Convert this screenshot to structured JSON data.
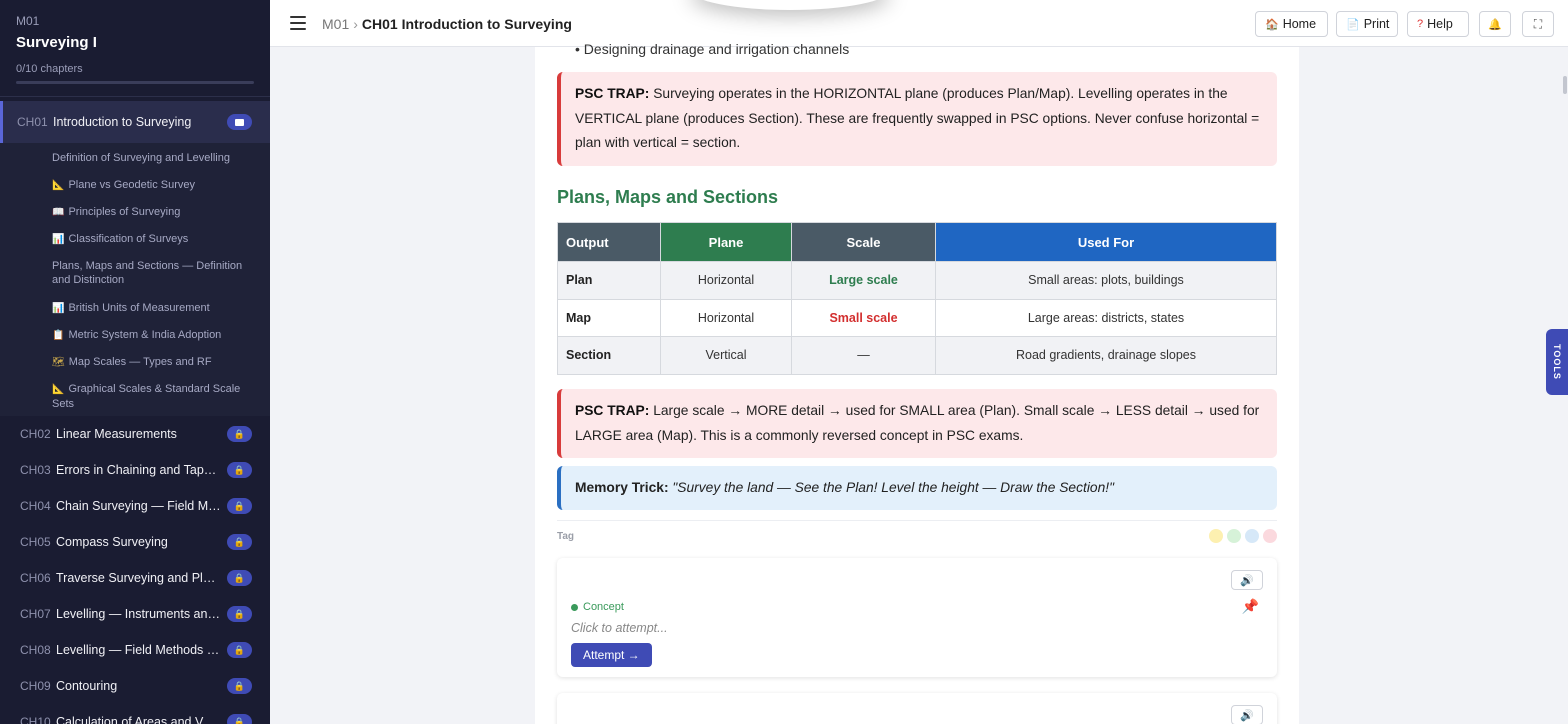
{
  "sidebar": {
    "module": "M01",
    "course_title": "Surveying I",
    "progress": "0/10 chapters",
    "progress_fraction": 0,
    "active_chapter": {
      "code": "CH01",
      "name": "Introduction to Surveying"
    },
    "subtopics": [
      {
        "icon": "",
        "label": "Definition of Surveying and Levelling"
      },
      {
        "icon": "📐",
        "label": "Plane vs Geodetic Survey"
      },
      {
        "icon": "📖",
        "label": "Principles of Surveying"
      },
      {
        "icon": "📊",
        "label": "Classification of Surveys"
      },
      {
        "icon": "",
        "label": "Plans, Maps and Sections — Definition and Distinction"
      },
      {
        "icon": "📊",
        "label": "British Units of Measurement"
      },
      {
        "icon": "📋",
        "label": "Metric System & India Adoption"
      },
      {
        "icon": "🗺",
        "label": "Map Scales — Types and RF"
      },
      {
        "icon": "📐",
        "label": "Graphical Scales & Standard Scale Sets"
      }
    ],
    "chapters": [
      {
        "code": "CH02",
        "name": "Linear Measurements"
      },
      {
        "code": "CH03",
        "name": "Errors in Chaining and Tape C..."
      },
      {
        "code": "CH04",
        "name": "Chain Surveying — Field Met..."
      },
      {
        "code": "CH05",
        "name": "Compass Surveying"
      },
      {
        "code": "CH06",
        "name": "Traverse Surveying and Plane ..."
      },
      {
        "code": "CH07",
        "name": "Levelling — Instruments and ..."
      },
      {
        "code": "CH08",
        "name": "Levelling — Field Methods an..."
      },
      {
        "code": "CH09",
        "name": "Contouring"
      },
      {
        "code": "CH10",
        "name": "Calculation of Areas and Volu..."
      }
    ]
  },
  "topbar": {
    "crumb_module": "M01",
    "crumb_separator": "›",
    "crumb_current": "CH01 Introduction to Surveying",
    "home": "Home",
    "print": "Print",
    "help": "Help"
  },
  "content": {
    "bullet_text": "Designing drainage and irrigation channels",
    "trap1": {
      "label": "PSC TRAP:",
      "text": " Surveying operates in the HORIZONTAL plane (produces Plan/Map). Levelling operates in the VERTICAL plane (produces Section). These are frequently swapped in PSC options. Never confuse horizontal = plan with vertical = section."
    },
    "section_heading": "Plans, Maps and Sections",
    "table": {
      "headers": [
        {
          "label": "Output",
          "color": "#4a5a66"
        },
        {
          "label": "Plane",
          "color": "#2e7d4f"
        },
        {
          "label": "Scale",
          "color": "#4a5a66"
        },
        {
          "label": "Used For",
          "color": "#1f66c2"
        }
      ],
      "rows": [
        {
          "output": "Plan",
          "plane": "Horizontal",
          "scale": "Large scale",
          "scale_color": "#2e7d4f",
          "used_for": "Small areas: plots, buildings"
        },
        {
          "output": "Map",
          "plane": "Horizontal",
          "scale": "Small scale",
          "scale_color": "#d32f2f",
          "used_for": "Large areas: districts, states"
        },
        {
          "output": "Section",
          "plane": "Vertical",
          "scale": "—",
          "scale_color": "#333333",
          "used_for": "Road gradients, drainage slopes"
        }
      ]
    },
    "trap2": {
      "label": "PSC TRAP:",
      "text": " Large scale → MORE detail → used for SMALL area (Plan). Small scale → LESS detail → used for LARGE area (Map). This is a commonly reversed concept in PSC exams."
    },
    "memory": {
      "label": "Memory Trick:",
      "quote": "\"Survey the land — See the Plan! Level the height — Draw the Section!\""
    },
    "tag_label": "Tag",
    "tag_colors": [
      "#fdf0b0",
      "#d6f2d8",
      "#d6e8f8",
      "#fbd9de"
    ],
    "card": {
      "type": "Concept",
      "hint": "Click to attempt...",
      "button": "Attempt →"
    }
  },
  "tools_label": "TOOLS"
}
